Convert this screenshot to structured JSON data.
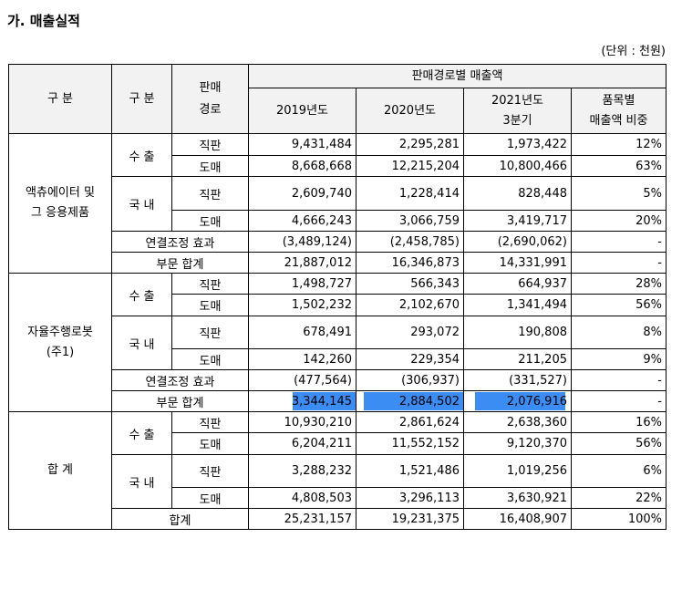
{
  "section_title": "가. 매출실적",
  "unit_note": "(단위 : 천원)",
  "header": {
    "category1": "구 분",
    "category2": "구 분",
    "channel": "판매\n경로",
    "group": "판매경로별 매출액",
    "y2019": "2019년도",
    "y2020": "2020년도",
    "y2021": "2021년도\n3분기",
    "ratio": "품목별\n매출액 비중"
  },
  "groups": [
    {
      "name": "액츄에이터 및\n그 응용제품",
      "subs": [
        {
          "name": "수 출",
          "rows": [
            {
              "channel": "직판",
              "y2019": "9,431,484",
              "y2020": "2,295,281",
              "y2021": "1,973,422",
              "ratio": "12%"
            },
            {
              "channel": "도매",
              "y2019": "8,668,668",
              "y2020": "12,215,204",
              "y2021": "10,800,466",
              "ratio": "63%"
            }
          ]
        },
        {
          "name": "국 내",
          "rows": [
            {
              "channel": "직판",
              "y2019": "2,609,740",
              "y2020": "1,228,414",
              "y2021": "828,448",
              "ratio": "5%"
            },
            {
              "channel": "도매",
              "y2019": "4,666,243",
              "y2020": "3,066,759",
              "y2021": "3,419,717",
              "ratio": "20%"
            }
          ]
        }
      ],
      "adjust": {
        "label": "연결조정 효과",
        "y2019": "(3,489,124)",
        "y2020": "(2,458,785)",
        "y2021": "(2,690,062)",
        "ratio": "-"
      },
      "subtotal": {
        "label": "부문 합계",
        "y2019": "21,887,012",
        "y2020": "16,346,873",
        "y2021": "14,331,991",
        "ratio": "-"
      }
    },
    {
      "name": "자율주행로봇\n(주1)",
      "subs": [
        {
          "name": "수 출",
          "rows": [
            {
              "channel": "직판",
              "y2019": "1,498,727",
              "y2020": "566,343",
              "y2021": "664,937",
              "ratio": "28%"
            },
            {
              "channel": "도매",
              "y2019": "1,502,232",
              "y2020": "2,102,670",
              "y2021": "1,341,494",
              "ratio": "56%"
            }
          ]
        },
        {
          "name": "국 내",
          "rows": [
            {
              "channel": "직판",
              "y2019": "678,491",
              "y2020": "293,072",
              "y2021": "190,808",
              "ratio": "8%"
            },
            {
              "channel": "도매",
              "y2019": "142,260",
              "y2020": "229,354",
              "y2021": "211,205",
              "ratio": "9%"
            }
          ]
        }
      ],
      "adjust": {
        "label": "연결조정 효과",
        "y2019": "(477,564)",
        "y2020": "(306,937)",
        "y2021": "(331,527)",
        "ratio": "-"
      },
      "subtotal": {
        "label": "부문 합계",
        "y2019": "3,344,145",
        "y2020": "2,884,502",
        "y2021": "2,076,916",
        "ratio": "-"
      }
    },
    {
      "name": "합 계",
      "subs": [
        {
          "name": "수 출",
          "rows": [
            {
              "channel": "직판",
              "y2019": "10,930,210",
              "y2020": "2,861,624",
              "y2021": "2,638,360",
              "ratio": "16%"
            },
            {
              "channel": "도매",
              "y2019": "6,204,211",
              "y2020": "11,552,152",
              "y2021": "9,120,370",
              "ratio": "56%"
            }
          ]
        },
        {
          "name": "국 내",
          "rows": [
            {
              "channel": "직판",
              "y2019": "3,288,232",
              "y2020": "1,521,486",
              "y2021": "1,019,256",
              "ratio": "6%"
            },
            {
              "channel": "도매",
              "y2019": "4,808,503",
              "y2020": "3,296,113",
              "y2021": "3,630,921",
              "ratio": "22%"
            }
          ]
        }
      ],
      "total": {
        "label": "합계",
        "y2019": "25,231,157",
        "y2020": "19,231,375",
        "y2021": "16,408,907",
        "ratio": "100%"
      }
    }
  ]
}
